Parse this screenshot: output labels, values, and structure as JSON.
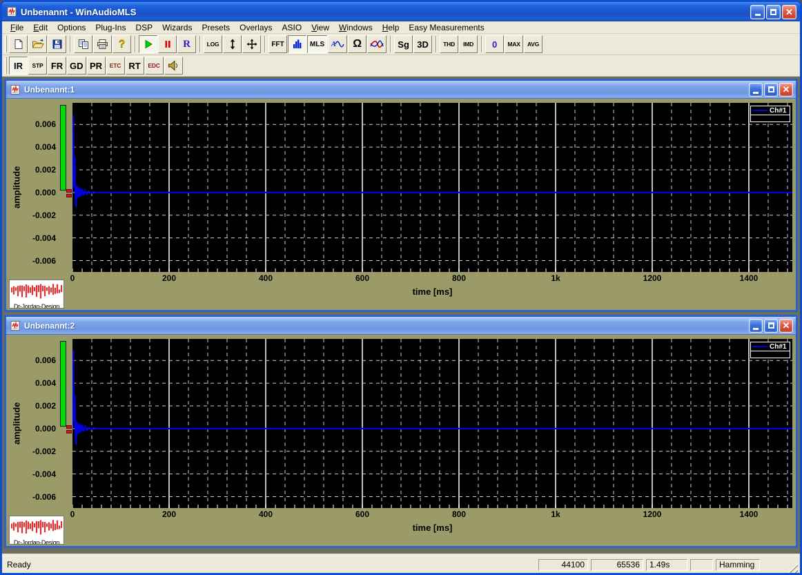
{
  "window": {
    "title": "Unbenannt - WinAudioMLS"
  },
  "menu": {
    "items": [
      {
        "label": "File",
        "accel": 0
      },
      {
        "label": "Edit",
        "accel": 0
      },
      {
        "label": "Options",
        "accel": -1
      },
      {
        "label": "Plug-Ins",
        "accel": -1
      },
      {
        "label": "DSP",
        "accel": -1
      },
      {
        "label": "Wizards",
        "accel": -1
      },
      {
        "label": "Presets",
        "accel": -1
      },
      {
        "label": "Overlays",
        "accel": -1
      },
      {
        "label": "ASIO",
        "accel": -1
      },
      {
        "label": "View",
        "accel": 0
      },
      {
        "label": "Windows",
        "accel": 0
      },
      {
        "label": "Help",
        "accel": 0
      },
      {
        "label": "Easy Measurements",
        "accel": -1
      }
    ]
  },
  "toolbars": {
    "row1": [
      {
        "name": "new-button",
        "icon": "new-document-icon"
      },
      {
        "name": "open-button",
        "icon": "open-folder-icon"
      },
      {
        "name": "save-button",
        "icon": "save-icon"
      },
      {
        "sep": true
      },
      {
        "name": "copy-button",
        "icon": "copy-icon"
      },
      {
        "name": "print-button",
        "icon": "print-icon"
      },
      {
        "name": "help-button",
        "icon": "help-icon"
      },
      {
        "sep": true
      },
      {
        "name": "play-button",
        "icon": "play-icon",
        "pressed": true
      },
      {
        "name": "pause-button",
        "icon": "pause-icon"
      },
      {
        "name": "record-button",
        "label": "R",
        "cls": "blue-r"
      },
      {
        "sep": true
      },
      {
        "name": "log-scale-button",
        "label": "LOG",
        "cls": "tiny"
      },
      {
        "name": "vertical-zoom-button",
        "icon": "updown-arrow-icon"
      },
      {
        "name": "autoscale-button",
        "icon": "move-arrows-icon"
      },
      {
        "sep": true
      },
      {
        "name": "fft-button",
        "label": "FFT",
        "cls": "small"
      },
      {
        "name": "spectrum-bars-button",
        "icon": "spectrum-bars-icon",
        "pressed": true
      },
      {
        "name": "mls-button",
        "label": "MLS",
        "cls": "small",
        "pressed": true
      },
      {
        "name": "sine-generator-button",
        "icon": "sine-wave-icon"
      },
      {
        "name": "impedance-button",
        "icon": "omega-icon"
      },
      {
        "name": "overlay-curves-button",
        "icon": "curves-icon"
      },
      {
        "sep": true
      },
      {
        "name": "sg-button",
        "label": "Sg",
        "cls": "big"
      },
      {
        "name": "3d-button",
        "label": "3D",
        "cls": "big"
      },
      {
        "sep": true
      },
      {
        "name": "thd-button",
        "label": "THD",
        "cls": "tiny"
      },
      {
        "name": "imd-button",
        "label": "IMD",
        "cls": "tiny"
      },
      {
        "sep": true
      },
      {
        "name": "zero-button",
        "label": "0",
        "cls": "blue-zero"
      },
      {
        "name": "max-button",
        "label": "MAX",
        "cls": "tiny"
      },
      {
        "name": "avg-button",
        "label": "AVG",
        "cls": "tiny"
      }
    ],
    "row2": [
      {
        "name": "ir-button",
        "label": "IR",
        "cls": "big",
        "pressed": true
      },
      {
        "name": "stp-button",
        "label": "STP",
        "cls": "tiny"
      },
      {
        "name": "fr-button",
        "label": "FR",
        "cls": "big"
      },
      {
        "name": "gd-button",
        "label": "GD",
        "cls": "big"
      },
      {
        "name": "pr-button",
        "label": "PR",
        "cls": "big"
      },
      {
        "name": "etc-button",
        "label": "ETC",
        "cls": "tiny darkred"
      },
      {
        "name": "rt-button",
        "label": "RT",
        "cls": "big"
      },
      {
        "name": "edc-button",
        "label": "EDC",
        "cls": "tiny darkred"
      },
      {
        "name": "speaker-button",
        "icon": "speaker-icon"
      }
    ]
  },
  "children": [
    {
      "title": "Unbenannt:1"
    },
    {
      "title": "Unbenannt:2"
    }
  ],
  "logo": {
    "text": "Dr-Jordan-Design"
  },
  "statusbar": {
    "ready": "Ready",
    "panels": [
      {
        "value": "44100",
        "align": "right",
        "width": 72
      },
      {
        "value": "65536",
        "align": "right",
        "width": 76
      },
      {
        "value": "1.49s",
        "align": "left",
        "width": 60
      },
      {
        "value": "",
        "align": "left",
        "width": 33
      },
      {
        "value": "Hamming",
        "align": "left",
        "width": 64
      }
    ]
  },
  "colors": {
    "content_bg": "#9b9b69",
    "plot_bg": "#000000",
    "curve": "#0000e0",
    "meter_green": "#00dd00",
    "marker_red": "#dd1111",
    "chrome": "#ece9d8",
    "grid_minor": "#d0d0d0",
    "grid_major": "#c0c0c0"
  },
  "chart_data": [
    {
      "type": "line",
      "title": "Unbenannt:1",
      "xlabel": "time [ms]",
      "ylabel": "amplitude",
      "xlim": [
        0,
        1490
      ],
      "ylim": [
        -0.007,
        0.0079
      ],
      "xticks": [
        [
          0,
          "0"
        ],
        [
          200,
          "200"
        ],
        [
          400,
          "400"
        ],
        [
          600,
          "600"
        ],
        [
          800,
          "800"
        ],
        [
          1000,
          "1k"
        ],
        [
          1200,
          "1200"
        ],
        [
          1400,
          "1400"
        ]
      ],
      "yticks": [
        0.006,
        0.004,
        0.002,
        0,
        -0.002,
        -0.004,
        -0.006
      ],
      "grid": {
        "v_minor_step": 40,
        "v_major_step": 200,
        "h_step": 0.002,
        "minor_style": "dashed",
        "major_style": "solid"
      },
      "axis_tick_step": 20,
      "legend": {
        "entries": [
          "Ch#1"
        ],
        "position": "top-right"
      },
      "series": [
        {
          "name": "Ch#1",
          "color": "#0000e0",
          "points": [
            [
              0,
              0
            ],
            [
              1,
              0.0004
            ],
            [
              2,
              0.0068
            ],
            [
              3,
              0.0012
            ],
            [
              4,
              0.0006
            ],
            [
              5,
              0.0031
            ],
            [
              6,
              -0.0002
            ],
            [
              7,
              -0.0013
            ],
            [
              8,
              -0.0004
            ],
            [
              9,
              0.0006
            ],
            [
              10,
              -0.0005
            ],
            [
              12,
              0.0005
            ],
            [
              14,
              -0.0004
            ],
            [
              16,
              0.0004
            ],
            [
              18,
              -0.0003
            ],
            [
              20,
              0.0003
            ],
            [
              23,
              -0.00025
            ],
            [
              26,
              0.0002
            ],
            [
              30,
              -0.00015
            ],
            [
              34,
              0.0001
            ],
            [
              38,
              -0.0001
            ],
            [
              43,
              8e-05
            ],
            [
              50,
              0
            ],
            [
              1490,
              0
            ]
          ]
        }
      ]
    },
    {
      "type": "line",
      "title": "Unbenannt:2",
      "xlabel": "time [ms]",
      "ylabel": "amplitude",
      "xlim": [
        0,
        1490
      ],
      "ylim": [
        -0.007,
        0.0079
      ],
      "xticks": [
        [
          0,
          "0"
        ],
        [
          200,
          "200"
        ],
        [
          400,
          "400"
        ],
        [
          600,
          "600"
        ],
        [
          800,
          "800"
        ],
        [
          1000,
          "1k"
        ],
        [
          1200,
          "1200"
        ],
        [
          1400,
          "1400"
        ]
      ],
      "yticks": [
        0.006,
        0.004,
        0.002,
        0,
        -0.002,
        -0.004,
        -0.006
      ],
      "grid": {
        "v_minor_step": 40,
        "v_major_step": 200,
        "h_step": 0.002,
        "minor_style": "dashed",
        "major_style": "solid"
      },
      "axis_tick_step": 20,
      "legend": {
        "entries": [
          "Ch#1"
        ],
        "position": "top-right"
      },
      "series": [
        {
          "name": "Ch#1",
          "color": "#0000e0",
          "points": [
            [
              0,
              0
            ],
            [
              1,
              0.0004
            ],
            [
              2,
              0.0069
            ],
            [
              3,
              0.0012
            ],
            [
              4,
              0.0006
            ],
            [
              5,
              0.003
            ],
            [
              6,
              -0.0002
            ],
            [
              7,
              -0.0014
            ],
            [
              8,
              -0.0004
            ],
            [
              9,
              0.0006
            ],
            [
              10,
              -0.0005
            ],
            [
              12,
              0.0005
            ],
            [
              14,
              -0.0004
            ],
            [
              16,
              0.0004
            ],
            [
              18,
              -0.0003
            ],
            [
              20,
              0.0003
            ],
            [
              23,
              -0.00025
            ],
            [
              26,
              0.0002
            ],
            [
              30,
              -0.00015
            ],
            [
              34,
              0.0001
            ],
            [
              38,
              -0.0001
            ],
            [
              43,
              8e-05
            ],
            [
              50,
              0
            ],
            [
              1490,
              0
            ]
          ]
        }
      ]
    }
  ]
}
